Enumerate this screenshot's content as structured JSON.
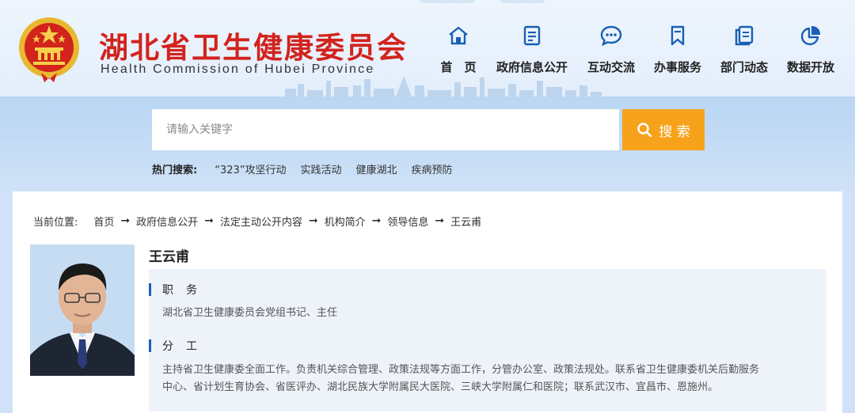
{
  "header": {
    "title": "湖北省卫生健康委员会",
    "subtitle": "Health Commission of Hubei Province",
    "emblem_icon": "national-emblem-icon"
  },
  "nav": {
    "items": [
      {
        "label": "首　页",
        "icon": "home-icon"
      },
      {
        "label": "政府信息公开",
        "icon": "document-icon"
      },
      {
        "label": "互动交流",
        "icon": "chat-icon"
      },
      {
        "label": "办事服务",
        "icon": "bookmark-icon"
      },
      {
        "label": "部门动态",
        "icon": "news-icon"
      },
      {
        "label": "数据开放",
        "icon": "pie-chart-icon"
      }
    ],
    "accent": "#1a5fb4"
  },
  "search": {
    "placeholder": "请输入关键字",
    "button_label": "搜 索",
    "button_color": "#f7a21b",
    "hot_label": "热门搜索:",
    "hot_items": [
      "“323”攻坚行动",
      "实践活动",
      "健康湖北",
      "疾病预防"
    ]
  },
  "breadcrumb": {
    "label": "当前位置:",
    "items": [
      "首页",
      "政府信息公开",
      "法定主动公开内容",
      "机构简介",
      "领导信息",
      "王云甫"
    ],
    "separator": "➞"
  },
  "profile": {
    "name": "王云甫",
    "position_title": "职务",
    "position": "湖北省卫生健康委员会党组书记、主任",
    "duty_title": "分工",
    "duty_line1": "主持省卫生健康委全面工作。负责机关综合管理、政策法规等方面工作，分管办公室、政策法规处。联系省卫生健康委机关后勤服务",
    "duty_line2": "中心、省计划生育协会、省医评办、湖北民族大学附属民大医院、三峡大学附属仁和医院；联系武汉市、宜昌市、恩施州。"
  }
}
